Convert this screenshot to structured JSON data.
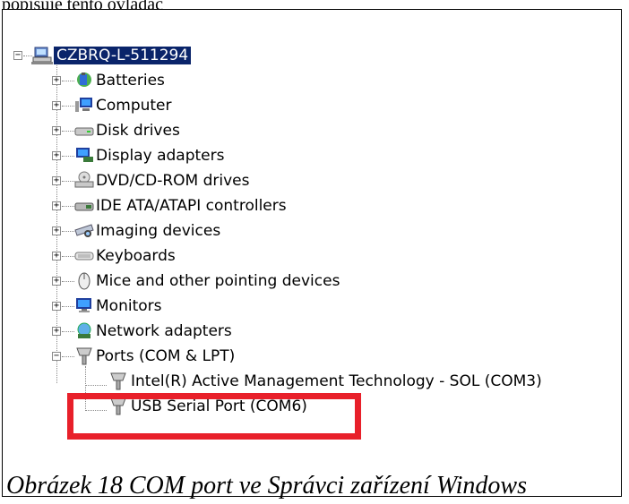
{
  "top_text": "popisuje tento ovladač",
  "root": {
    "label": "CZBRQ-L-511294",
    "icon": "computer-network-icon"
  },
  "nodes": [
    {
      "label": "Batteries",
      "icon": "battery-icon",
      "expander": "+"
    },
    {
      "label": "Computer",
      "icon": "computer-icon",
      "expander": "+"
    },
    {
      "label": "Disk drives",
      "icon": "disk-drive-icon",
      "expander": "+"
    },
    {
      "label": "Display adapters",
      "icon": "display-adapter-icon",
      "expander": "+"
    },
    {
      "label": "DVD/CD-ROM drives",
      "icon": "optical-drive-icon",
      "expander": "+"
    },
    {
      "label": "IDE ATA/ATAPI controllers",
      "icon": "ide-controller-icon",
      "expander": "+"
    },
    {
      "label": "Imaging devices",
      "icon": "imaging-device-icon",
      "expander": "+"
    },
    {
      "label": "Keyboards",
      "icon": "keyboard-icon",
      "expander": "+"
    },
    {
      "label": "Mice and other pointing devices",
      "icon": "mouse-icon",
      "expander": "+"
    },
    {
      "label": "Monitors",
      "icon": "monitor-icon",
      "expander": "+"
    },
    {
      "label": "Network adapters",
      "icon": "network-adapter-icon",
      "expander": "+"
    },
    {
      "label": "Ports (COM & LPT)",
      "icon": "port-connector-icon",
      "expander": "−"
    }
  ],
  "children": [
    {
      "label": "Intel(R) Active Management Technology - SOL (COM3)",
      "icon": "port-connector-icon"
    },
    {
      "label": "USB Serial Port (COM6)",
      "icon": "port-connector-icon"
    }
  ],
  "highlight_color": "#e8202a",
  "selection_color": "#0a246a",
  "caption": "Obrázek 18 COM port ve Správci zařízení Windows"
}
